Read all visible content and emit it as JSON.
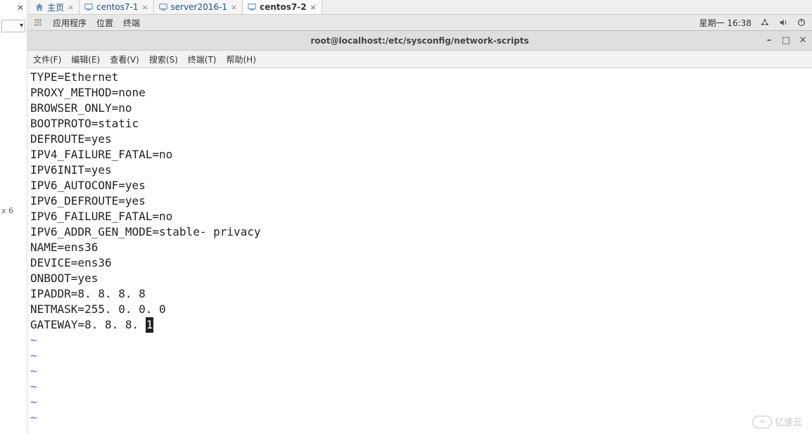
{
  "left_panel": {
    "label": "x 6"
  },
  "vm_tabs": [
    {
      "label": "主页",
      "type": "home",
      "active": false
    },
    {
      "label": "centos7-1",
      "type": "vm",
      "active": false
    },
    {
      "label": "server2016-1",
      "type": "vm",
      "active": false
    },
    {
      "label": "centos7-2",
      "type": "vm",
      "active": true
    }
  ],
  "gnome": {
    "apps": "应用程序",
    "places": "位置",
    "terminal": "终端",
    "datetime": "星期一 16:38"
  },
  "window": {
    "title": "root@localhost:/etc/sysconfig/network-scripts"
  },
  "terminal_menu": [
    "文件(F)",
    "编辑(E)",
    "查看(V)",
    "搜索(S)",
    "终端(T)",
    "帮助(H)"
  ],
  "config_lines": [
    "TYPE=Ethernet",
    "PROXY_METHOD=none",
    "BROWSER_ONLY=no",
    "BOOTPROTO=static",
    "DEFROUTE=yes",
    "IPV4_FAILURE_FATAL=no",
    "IPV6INIT=yes",
    "IPV6_AUTOCONF=yes",
    "IPV6_DEFROUTE=yes",
    "IPV6_FAILURE_FATAL=no",
    "IPV6_ADDR_GEN_MODE=stable- privacy",
    "NAME=ens36",
    "DEVICE=ens36",
    "ONBOOT=yes",
    "IPADDR=8. 8. 8. 8",
    "NETMASK=255. 0. 0. 0"
  ],
  "cursor_line": {
    "prefix": "GATEWAY=8. 8. 8. ",
    "cursor_char": "1"
  },
  "tilde_count": 6,
  "watermark": "亿速云"
}
